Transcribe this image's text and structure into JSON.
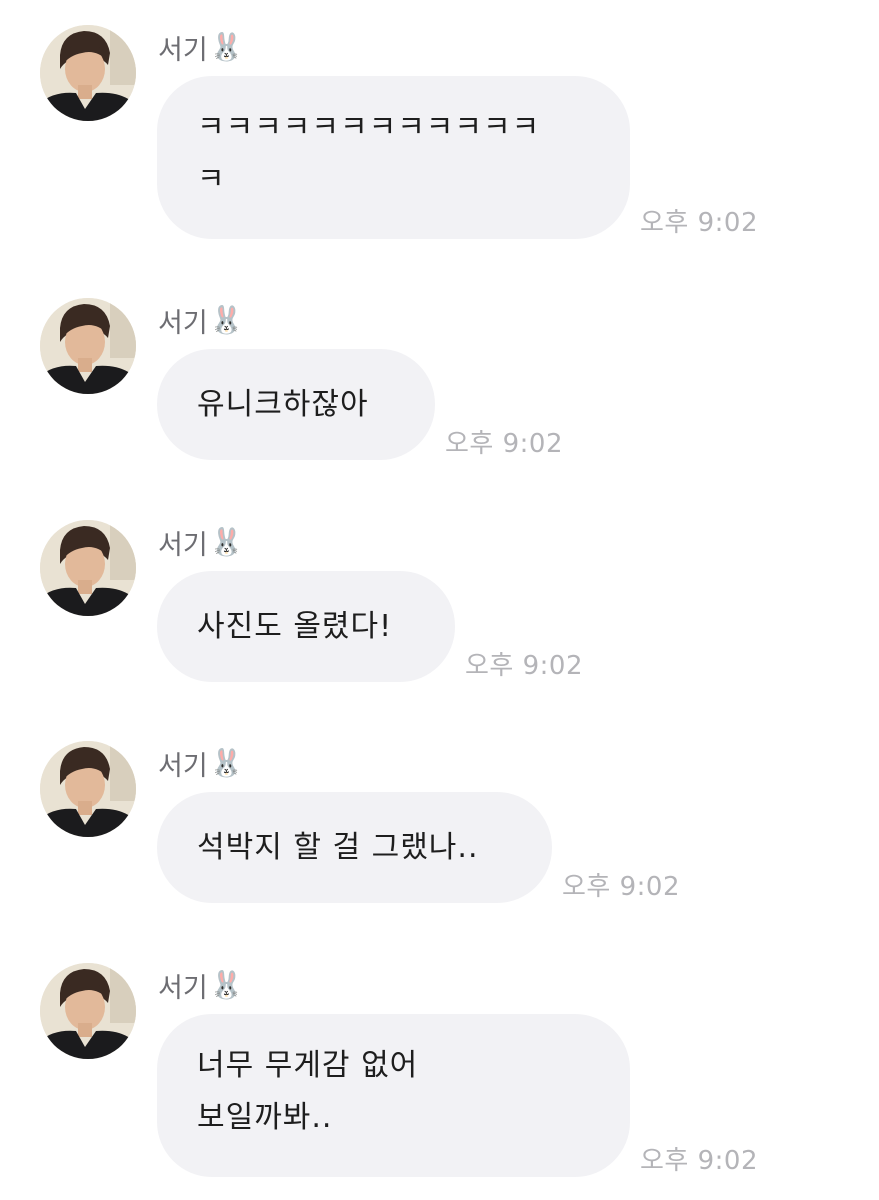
{
  "messages": [
    {
      "sender": "서기",
      "sender_emoji": "🐰",
      "lines": [
        "ㅋㅋㅋㅋㅋㅋㅋㅋㅋㅋㅋㅋ",
        "ㅋ"
      ],
      "time": "오후 9:02"
    },
    {
      "sender": "서기",
      "sender_emoji": "🐰",
      "lines": [
        "유니크하잖아"
      ],
      "time": "오후 9:02"
    },
    {
      "sender": "서기",
      "sender_emoji": "🐰",
      "lines": [
        "사진도 올렸다!"
      ],
      "time": "오후 9:02"
    },
    {
      "sender": "서기",
      "sender_emoji": "🐰",
      "lines": [
        "석박지 할 걸 그랬나.."
      ],
      "time": "오후 9:02"
    },
    {
      "sender": "서기",
      "sender_emoji": "🐰",
      "lines": [
        "너무 무게감 없어",
        "보일까봐.."
      ],
      "time": "오후 9:02"
    }
  ],
  "colors": {
    "bubble": "#f2f2f5",
    "message_text": "#1e1e1e",
    "sender_text": "#6d6d72",
    "time_text": "#b4b4b8"
  },
  "icons": {
    "avatar": "profile-photo",
    "sender_emoji": "rabbit-face-emoji"
  }
}
